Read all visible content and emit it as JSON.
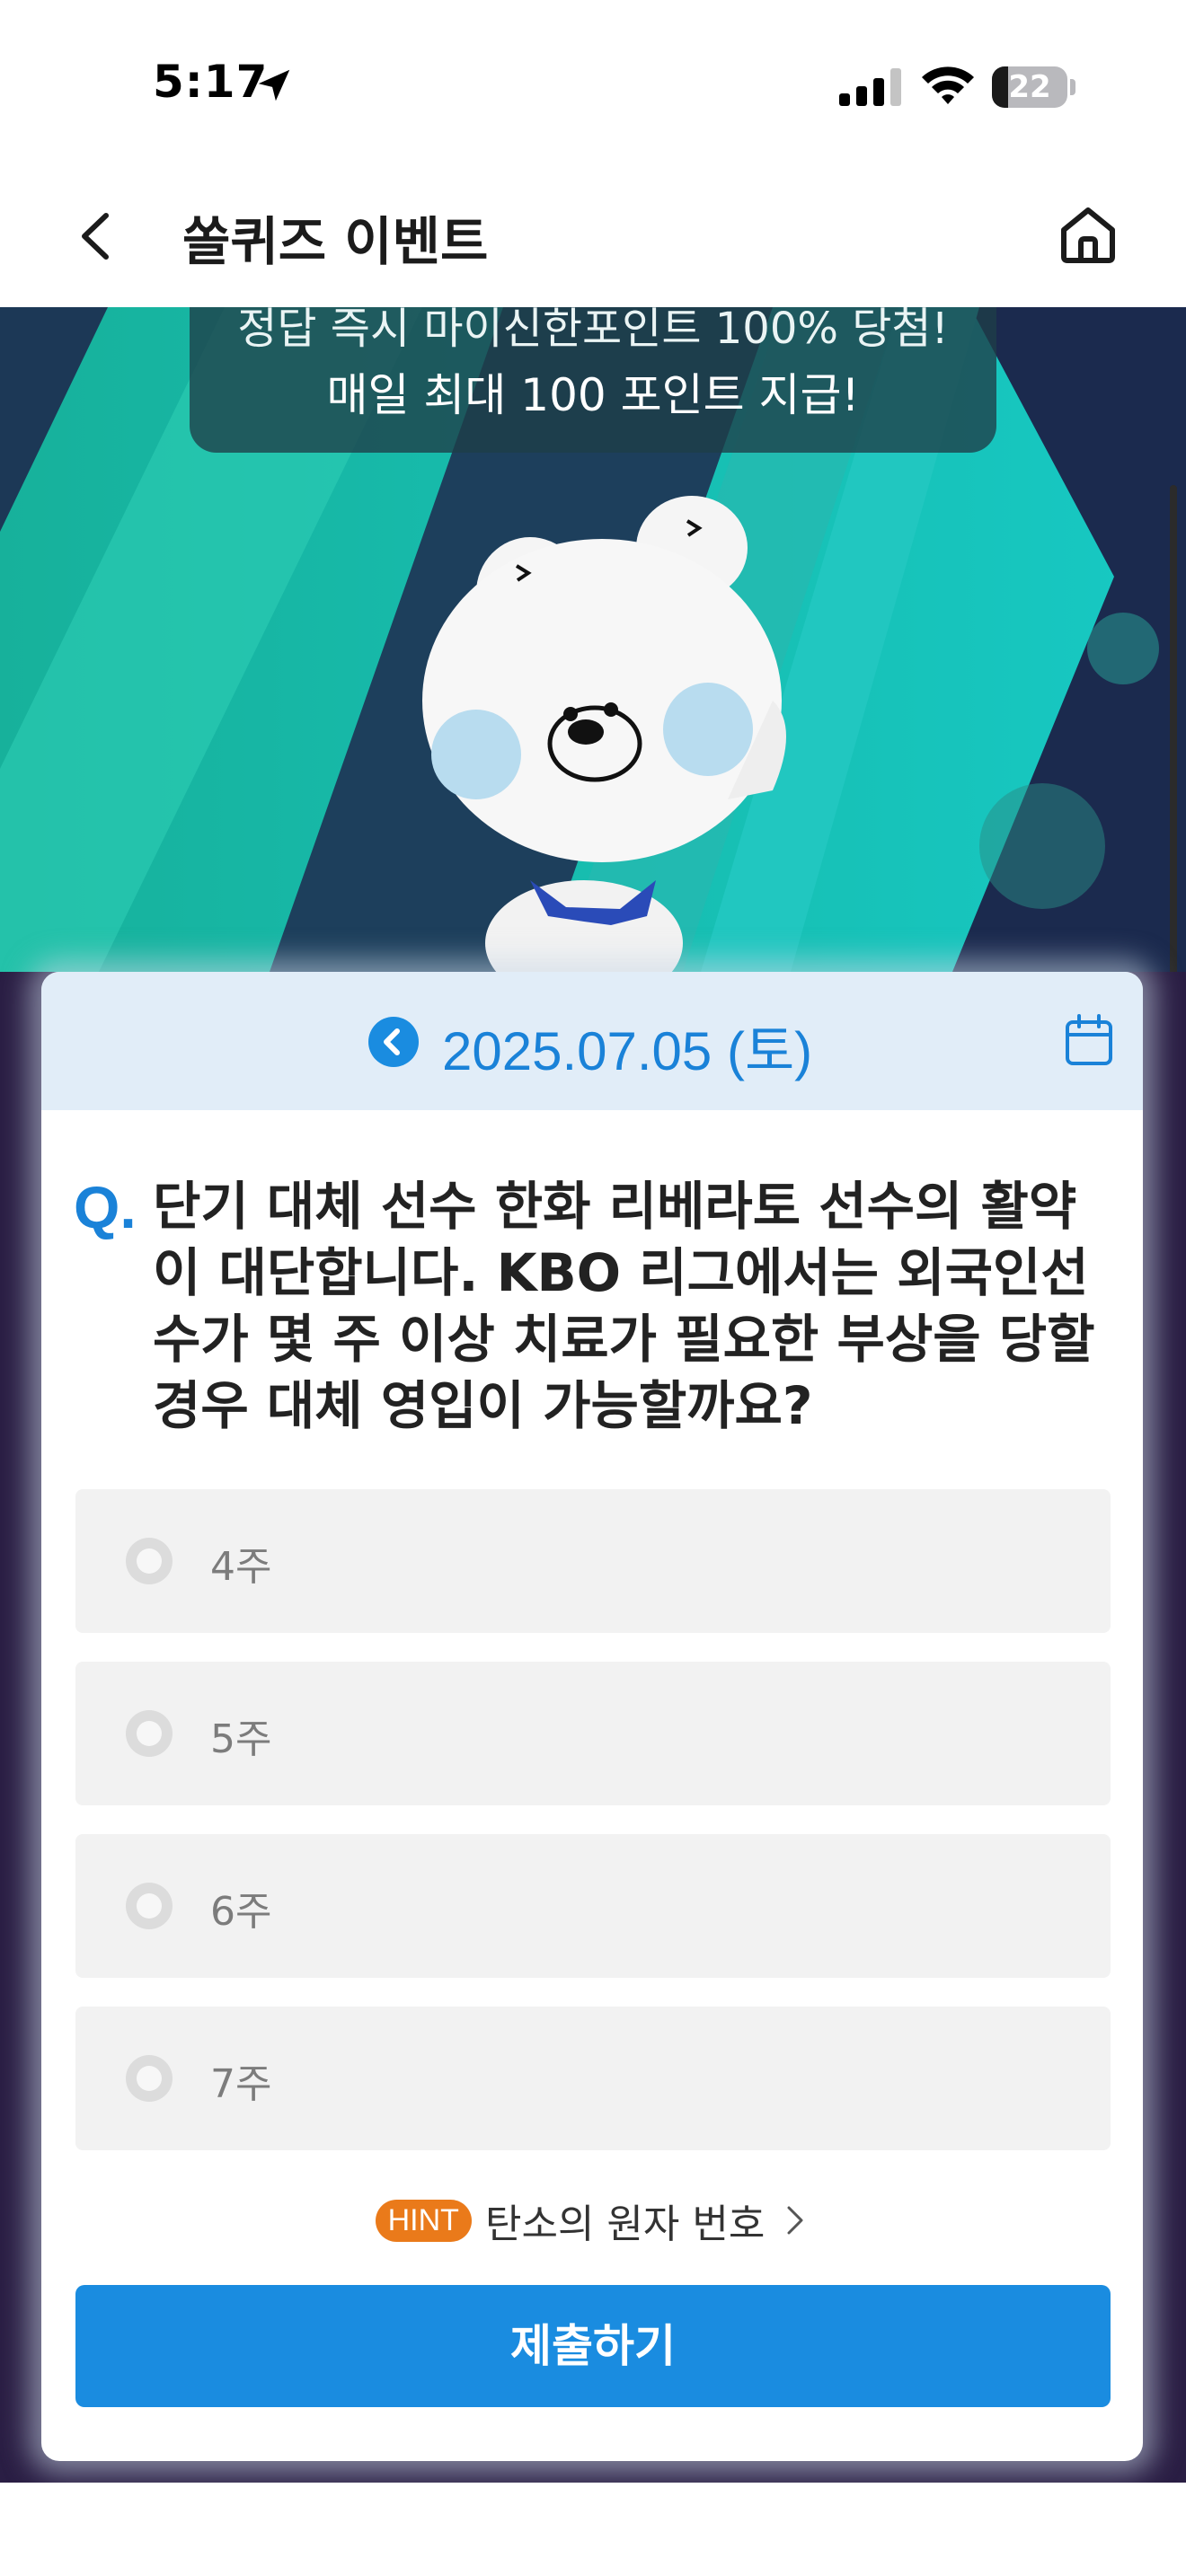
{
  "status_bar": {
    "time": "5:17",
    "battery": "22",
    "battery_level": 0.22,
    "icons": [
      "location-arrow-icon",
      "cellular-signal-icon",
      "wifi-icon",
      "battery-icon"
    ]
  },
  "header": {
    "title": "쏠퀴즈 이벤트",
    "icons": [
      "back-chevron-icon",
      "home-icon"
    ]
  },
  "banner": {
    "notice_line1": "정답 즉시 마이신한포인트 100% 당첨!",
    "notice_line2": "매일 최대   100 포인트 지급!",
    "colors": {
      "teal": "#1fb9a8",
      "navy": "#1b2a4e"
    }
  },
  "quiz": {
    "date": "2025.07.05 (토)",
    "q_mark": "Q.",
    "question": "단기 대체 선수 한화 리베라토 선수의 활약이 대단합니다. KBO 리그에서는 외국인선수가 몇 주 이상 치료가 필요한 부상을 당할 경우 대체 영입이 가능할까요?",
    "options": [
      "4주",
      "5주",
      "6주",
      "7주"
    ],
    "hint_badge": "HINT",
    "hint_text": "탄소의 원자 번호",
    "submit_label": "제출하기",
    "colors": {
      "accent": "#1a8ce0",
      "hint": "#ea7a1a"
    }
  }
}
